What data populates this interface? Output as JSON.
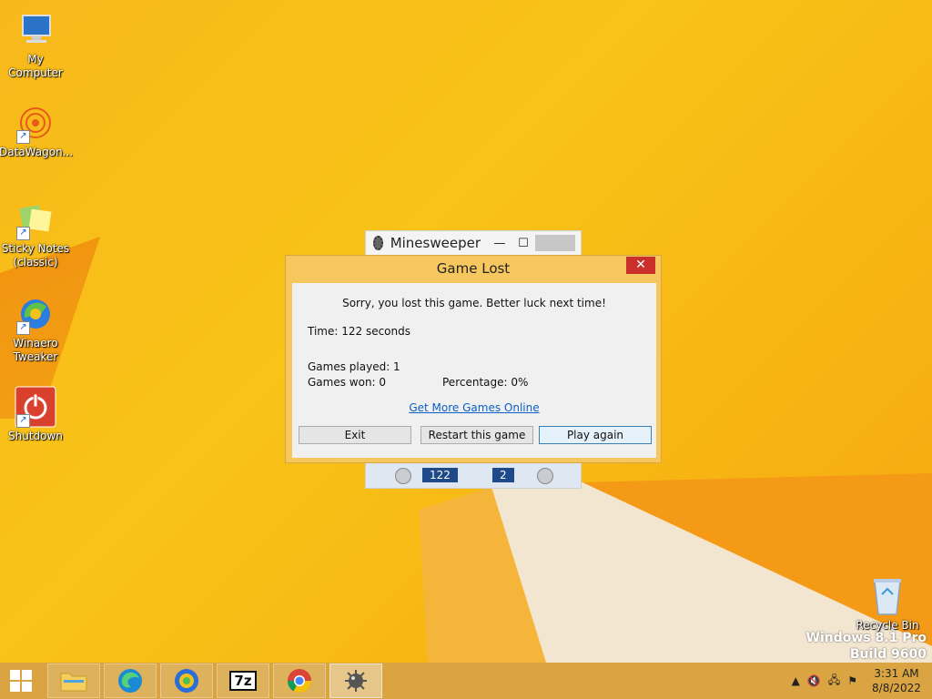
{
  "desktop": {
    "icons": [
      {
        "label": "My Computer"
      },
      {
        "label": "DataWagon..."
      },
      {
        "label": "Sticky Notes (classic)"
      },
      {
        "label": "Winaero Tweaker"
      },
      {
        "label": "Shutdown"
      },
      {
        "label": "Recycle Bin"
      }
    ],
    "watermark": {
      "line1": "Windows 8.1 Pro",
      "line2": "Build 9600"
    }
  },
  "minesweeper": {
    "title": "Minesweeper",
    "time_display": "122",
    "mines_display": "2"
  },
  "dialog": {
    "title": "Game Lost",
    "close_glyph": "✕",
    "message": "Sorry, you lost this game. Better luck next time!",
    "time": "Time: 122 seconds",
    "games_played": "Games played: 1",
    "games_won": "Games won: 0",
    "percentage": "Percentage: 0%",
    "link": "Get More Games Online",
    "buttons": {
      "exit": "Exit",
      "restart": "Restart this game",
      "play_again": "Play again"
    }
  },
  "taskbar": {
    "pinned": [
      "file-explorer",
      "edge",
      "edge-beta",
      "7-zip",
      "chrome",
      "minesweeper"
    ],
    "seven_zip_label": "7z",
    "clock": {
      "time": "3:31 AM",
      "date": "8/8/2022"
    }
  }
}
